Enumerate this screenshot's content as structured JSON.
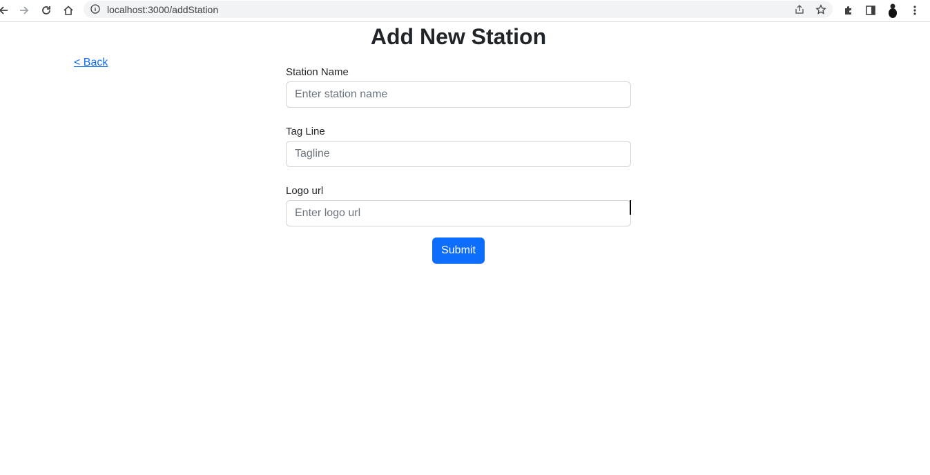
{
  "browser": {
    "url": "localhost:3000/addStation",
    "icons": [
      "back-arrow-icon",
      "forward-arrow-icon",
      "reload-icon",
      "home-icon",
      "info-icon",
      "share-icon",
      "star-icon",
      "extensions-icon",
      "side-panel-icon",
      "avatar",
      "kebab-menu-icon"
    ]
  },
  "page": {
    "title": "Add New Station",
    "back_link": "< Back"
  },
  "form": {
    "station_name": {
      "label": "Station Name",
      "placeholder": "Enter station name",
      "value": ""
    },
    "tag_line": {
      "label": "Tag Line",
      "placeholder": "Tagline",
      "value": ""
    },
    "logo_url": {
      "label": "Logo url",
      "placeholder": "Enter logo url",
      "value": ""
    },
    "submit_label": "Submit"
  },
  "colors": {
    "primary": "#0d6efd",
    "text": "#212529",
    "placeholder": "#6c757d",
    "input_border": "#ced4da"
  }
}
